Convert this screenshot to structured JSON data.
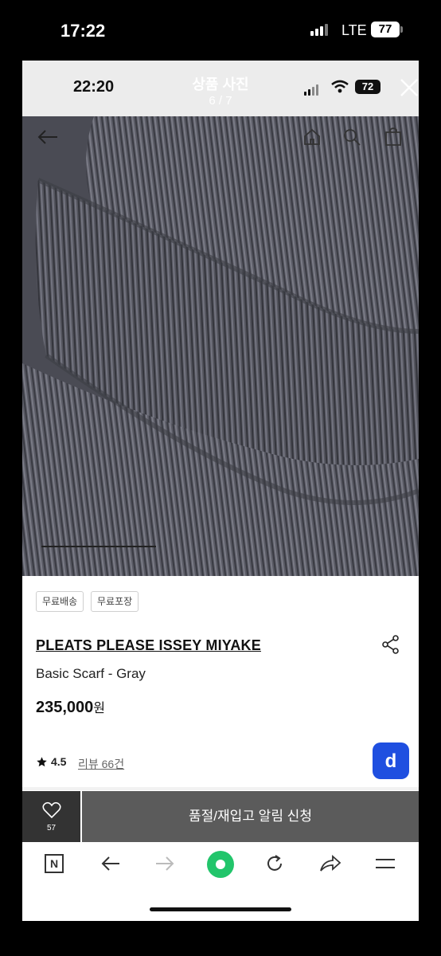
{
  "outer_status": {
    "time": "17:22",
    "network": "LTE",
    "battery": "77"
  },
  "inner_status": {
    "time": "22:20",
    "battery": "72"
  },
  "viewer": {
    "title": "상품 사진",
    "counter": "6 / 7"
  },
  "photo": {
    "progress": 0.29
  },
  "tags": [
    "무료배송",
    "무료포장"
  ],
  "product": {
    "brand": "PLEATS PLEASE ISSEY MIYAKE",
    "name": "Basic Scarf - Gray",
    "price": "235,000",
    "currency": "원",
    "rating": "4.5",
    "review": "리뷰 66건"
  },
  "actions": {
    "wish_count": "57",
    "restock": "품절/재입고 알림 신청"
  },
  "badge_letter": "d",
  "browser": {
    "n_label": "N"
  },
  "colors": {
    "badge": "#1f4fe0",
    "green_button": "#22c56b",
    "fabric": "#55565f"
  }
}
